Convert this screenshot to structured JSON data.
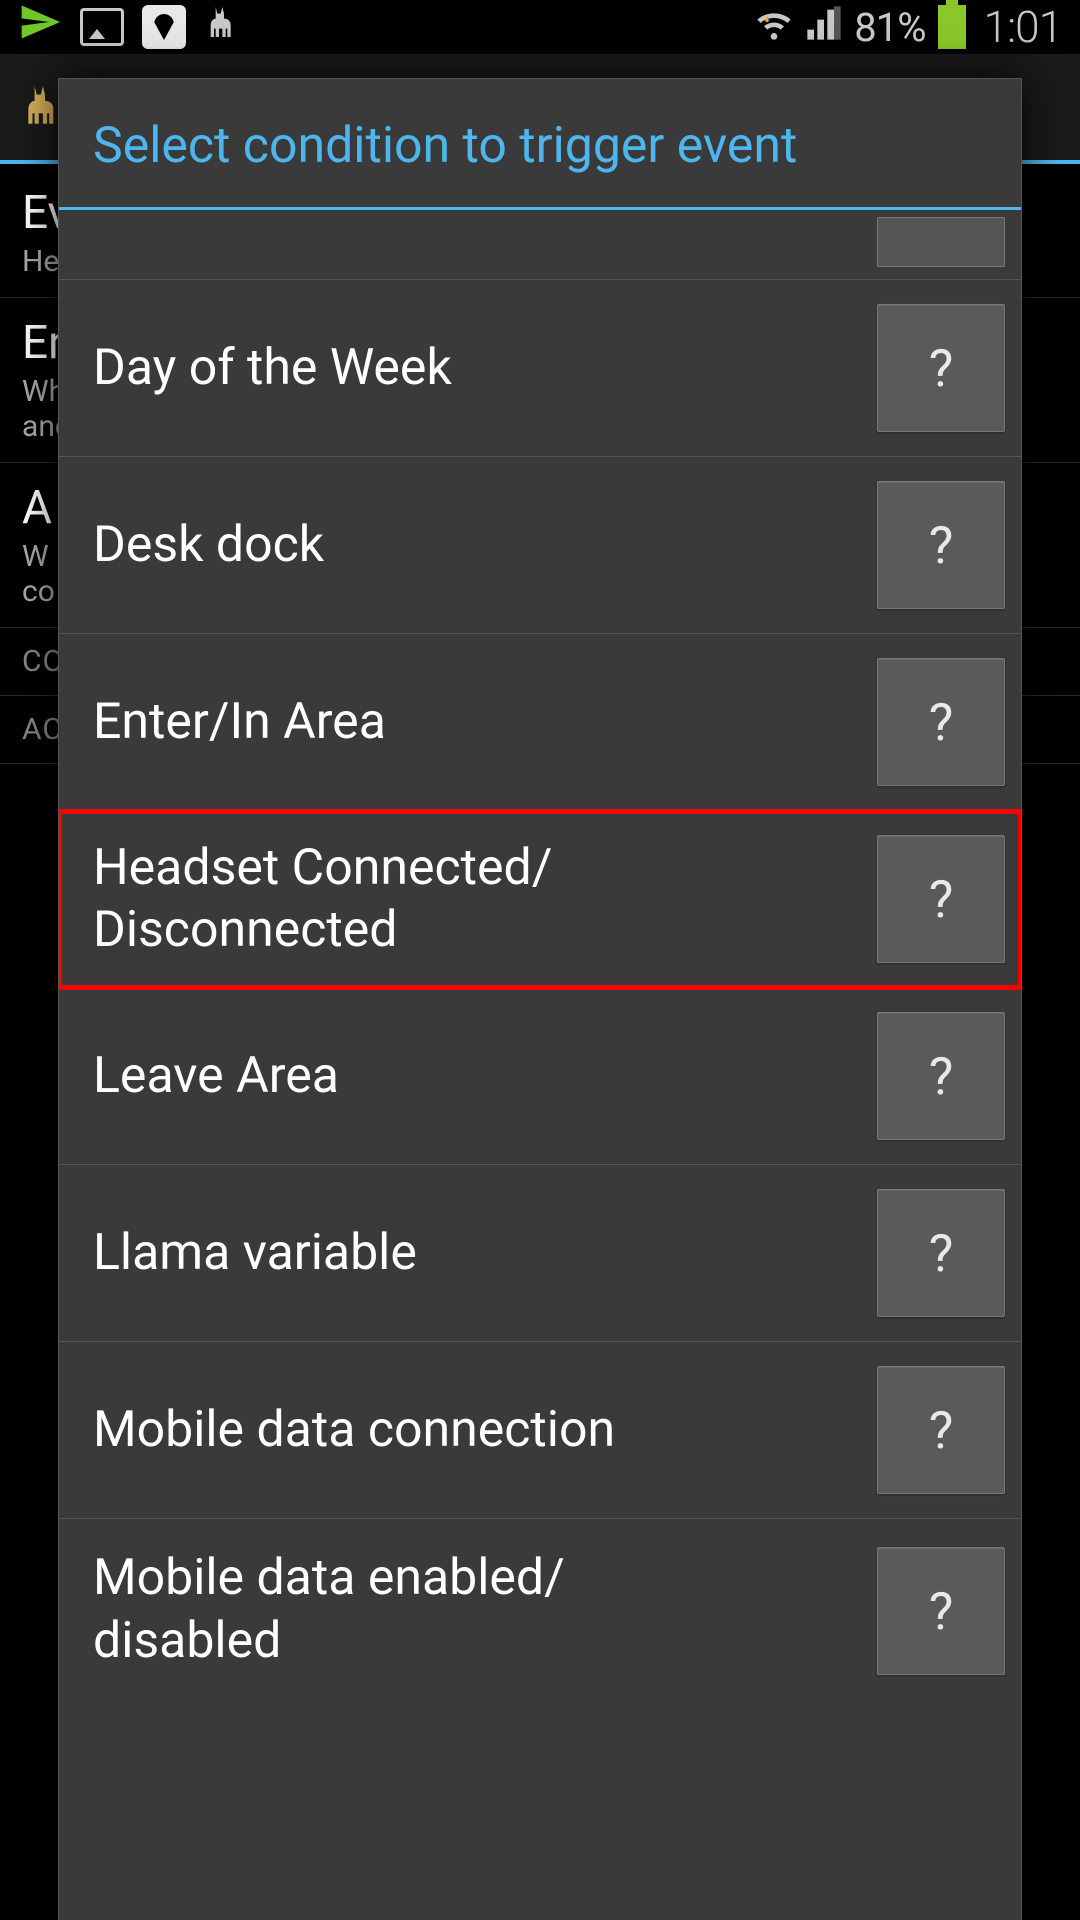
{
  "status_bar": {
    "battery_percent": "81%",
    "time": "1:01"
  },
  "background": {
    "rows": [
      {
        "title_fragment": "Ev",
        "sub_fragment": "He"
      },
      {
        "title_fragment": "En",
        "sub_fragment": "Wh\nanc"
      },
      {
        "title_fragment": "A",
        "sub_fragment": "W\nco"
      }
    ],
    "section_conditions": "CO",
    "section_actions": "AC"
  },
  "dialog": {
    "title": "Select condition to trigger event",
    "items": [
      {
        "label": "Day of the Week",
        "help": "?",
        "highlighted": false
      },
      {
        "label": "Desk dock",
        "help": "?",
        "highlighted": false
      },
      {
        "label": "Enter/In Area",
        "help": "?",
        "highlighted": false
      },
      {
        "label": "Headset Connected/\nDisconnected",
        "help": "?",
        "highlighted": true
      },
      {
        "label": "Leave Area",
        "help": "?",
        "highlighted": false
      },
      {
        "label": "Llama variable",
        "help": "?",
        "highlighted": false
      },
      {
        "label": "Mobile data connection",
        "help": "?",
        "highlighted": false
      },
      {
        "label": "Mobile data enabled/\ndisabled",
        "help": "?",
        "highlighted": false
      }
    ]
  }
}
